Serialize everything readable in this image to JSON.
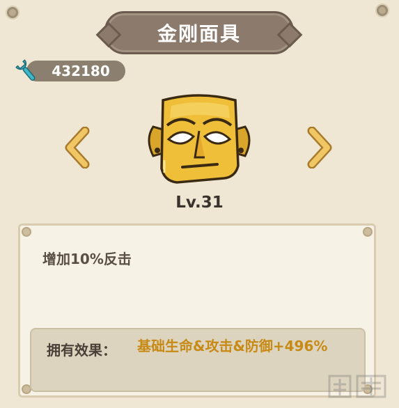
{
  "title": "金刚面具",
  "currency": {
    "icon": "wrench-icon",
    "amount": "432180"
  },
  "item": {
    "icon": "golden-mask-icon",
    "level": "Lv.31"
  },
  "navigation": {
    "prev_icon": "chevron-left-icon",
    "next_icon": "chevron-right-icon"
  },
  "description": "增加10%反击",
  "effect": {
    "label": "拥有效果：",
    "value": "基础生命&攻击&防御+496%"
  },
  "colors": {
    "background": "#efe7d3",
    "title_plate": "#8c7b6d",
    "arrow": "#e3b355",
    "effect_value": "#c78a15"
  }
}
